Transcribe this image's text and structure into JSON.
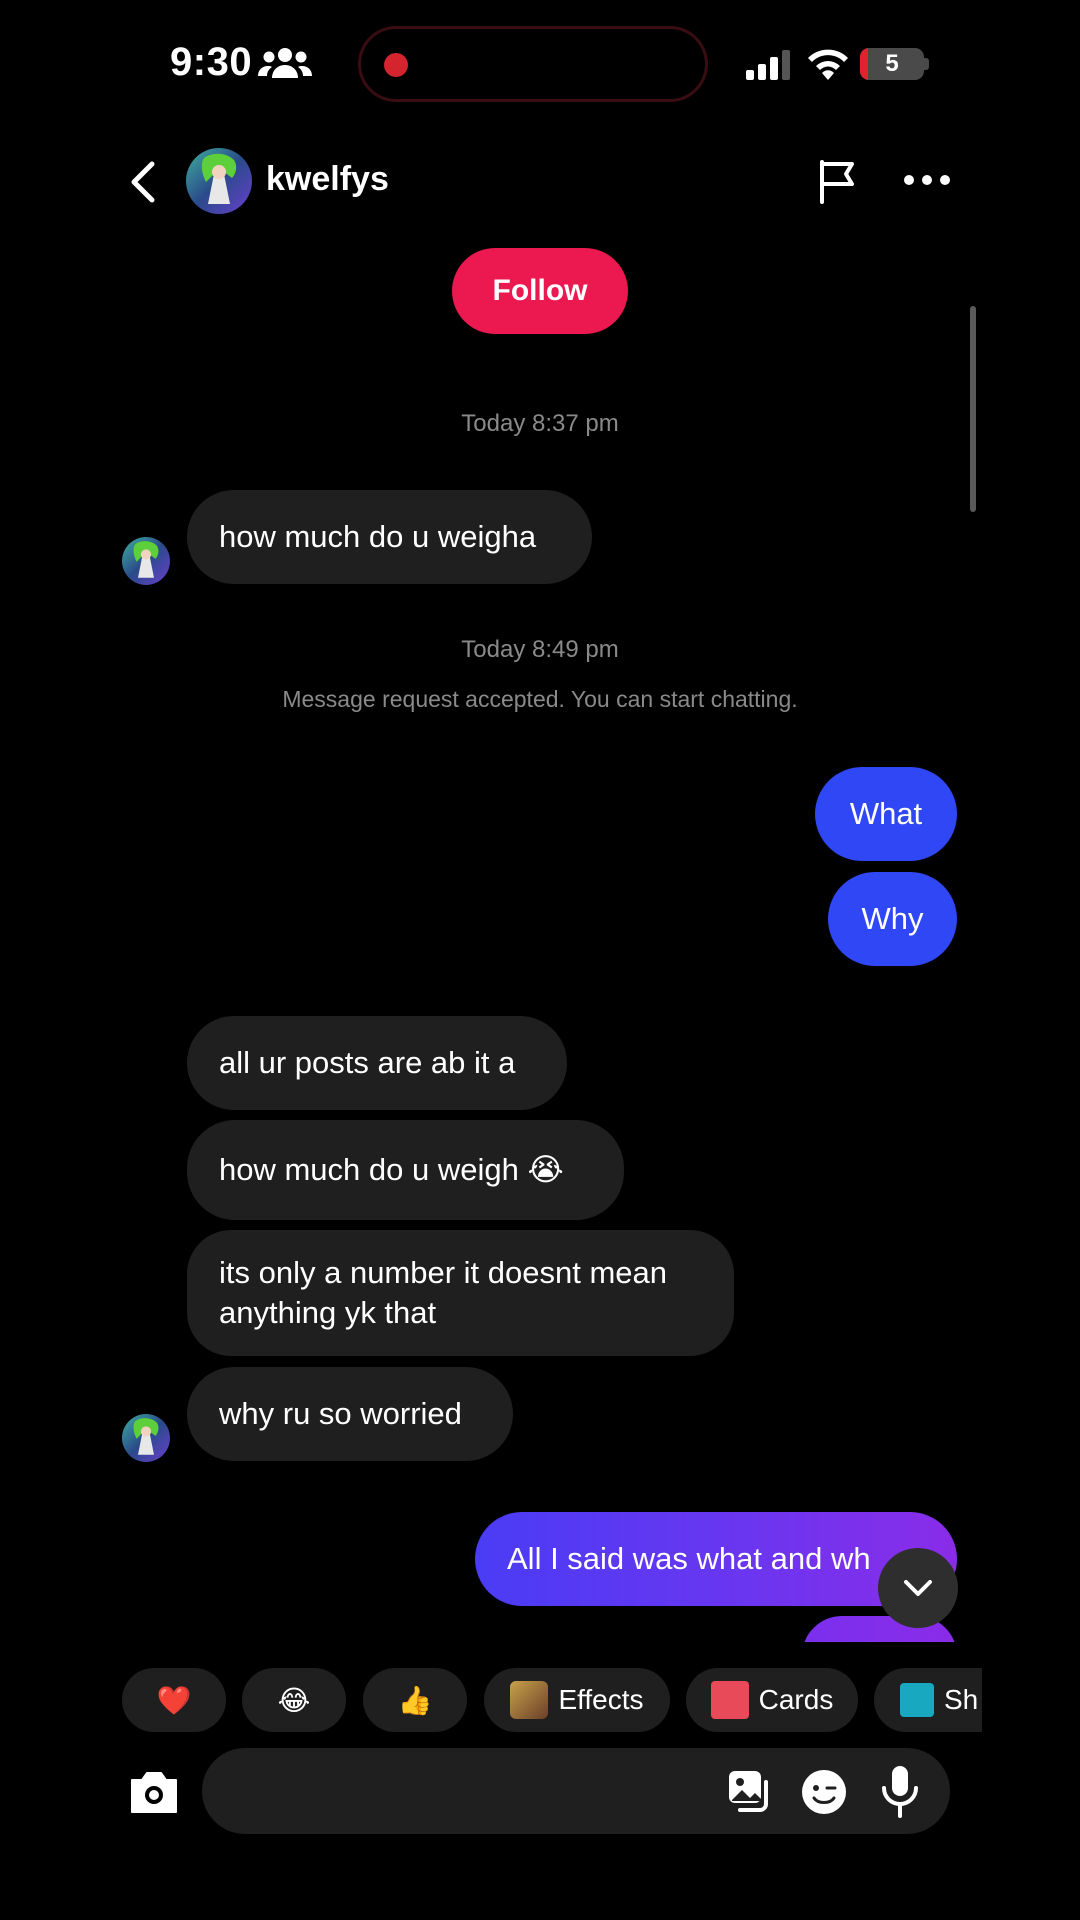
{
  "status_bar": {
    "time": "9:30",
    "battery": "5",
    "icons": [
      "people-icon",
      "signal-icon",
      "wifi-icon",
      "battery-icon"
    ]
  },
  "header": {
    "username": "kwelfys",
    "icons": [
      "back-icon",
      "flag-icon",
      "more-icon"
    ]
  },
  "follow_button": "Follow",
  "messages": [
    {
      "type": "timestamp",
      "text": "Today 8:37 pm"
    },
    {
      "type": "incoming",
      "text": "how much do u weigha"
    },
    {
      "type": "timestamp",
      "text": "Today 8:49 pm"
    },
    {
      "type": "system",
      "text": "Message request accepted. You can start chatting."
    },
    {
      "type": "outgoing",
      "text": "What"
    },
    {
      "type": "outgoing",
      "text": "Why"
    },
    {
      "type": "incoming",
      "text": "all ur posts are ab it a"
    },
    {
      "type": "incoming",
      "text": "how much do u weigh 😭"
    },
    {
      "type": "incoming",
      "text": "its only a number it doesnt mean anything yk that"
    },
    {
      "type": "incoming",
      "text": "why ru so worried"
    },
    {
      "type": "outgoing",
      "text": "All I said was what and wh"
    }
  ],
  "msg": {
    "ts1": "Today 8:37 pm",
    "m1": "how much do u weigha",
    "ts2": "Today 8:49 pm",
    "sys": "Message request accepted. You can start chatting.",
    "o1": "What",
    "o2": "Why",
    "i1": "all ur posts are ab it a",
    "i2": "how much do u weigh 😭",
    "i3a": "its only a number it doesnt mean",
    "i3b": "anything yk that",
    "i4": "why ru so worried",
    "o3": "All I said was what and wh"
  },
  "quick_actions": {
    "heart": "❤️",
    "laugh": "😂",
    "thumbs": "👍",
    "effects": "Effects",
    "cards": "Cards",
    "share": "Sh"
  },
  "input": {
    "placeholder": "",
    "icons": [
      "camera-icon",
      "gallery-icon",
      "sticker-icon",
      "mic-icon"
    ]
  },
  "colors": {
    "follow": "#eb1950",
    "outgoing_bubble": "#3047f5",
    "incoming_bubble": "#1f1f1f",
    "timestamp": "#8a8a8a"
  }
}
